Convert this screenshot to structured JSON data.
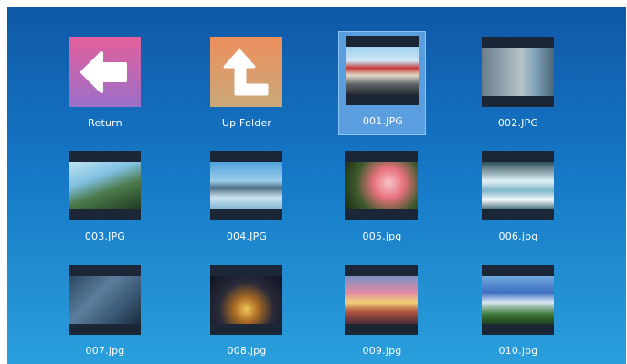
{
  "grid": {
    "items": [
      {
        "label": "Return",
        "kind": "return-icon"
      },
      {
        "label": "Up Folder",
        "kind": "up-folder-icon"
      },
      {
        "label": "001.JPG",
        "kind": "image",
        "selected": true
      },
      {
        "label": "002.JPG",
        "kind": "image"
      },
      {
        "label": "003.JPG",
        "kind": "image"
      },
      {
        "label": "004.JPG",
        "kind": "image"
      },
      {
        "label": "005.jpg",
        "kind": "image"
      },
      {
        "label": "006.jpg",
        "kind": "image"
      },
      {
        "label": "007.jpg",
        "kind": "image"
      },
      {
        "label": "008.jpg",
        "kind": "image"
      },
      {
        "label": "009.jpg",
        "kind": "image"
      },
      {
        "label": "010.jpg",
        "kind": "image"
      }
    ]
  },
  "colors": {
    "background_top": "#0f58a8",
    "background_bottom": "#2a9fdc",
    "selection": "#5a9ee0"
  }
}
